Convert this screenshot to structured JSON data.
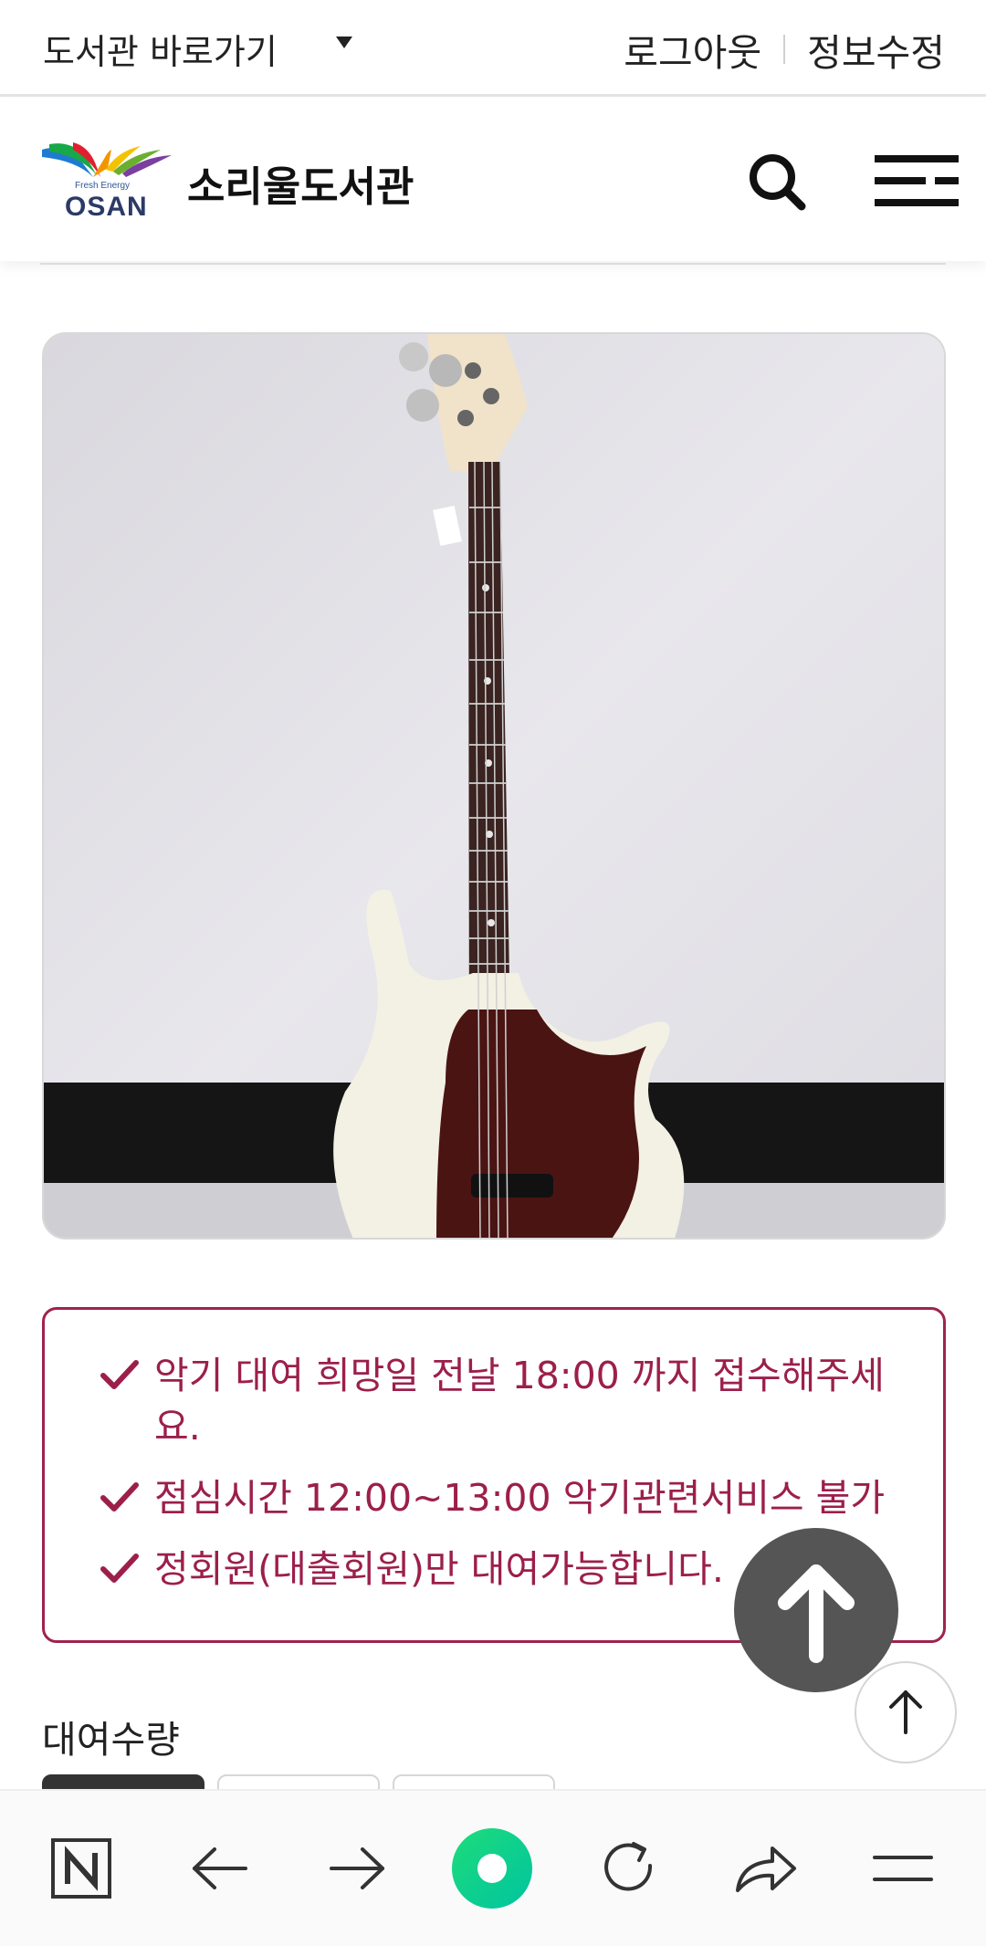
{
  "util_bar": {
    "library_select": "도서관 바로가기",
    "logout": "로그아웃",
    "edit_info": "정보수정"
  },
  "header": {
    "logo_sub": "Fresh Energy",
    "logo_text": "OSAN",
    "site_title": "소리울도서관"
  },
  "notice": {
    "items": [
      "악기 대여 희망일 전날 18:00 까지 접수해주세요.",
      "점심시간 12:00~13:00 악기관련서비스 불가",
      "정회원(대출회원)만 대여가능합니다."
    ]
  },
  "rental": {
    "quantity_label": "대여수량"
  },
  "colors": {
    "accent": "#9c1f4b",
    "fab": "#555555",
    "browser_brand": "#1ddc7a"
  },
  "toolbar": {
    "icons": [
      "naver-n-icon",
      "back-arrow-icon",
      "forward-arrow-icon",
      "home-circle-icon",
      "refresh-icon",
      "share-icon",
      "menu-icon"
    ]
  }
}
